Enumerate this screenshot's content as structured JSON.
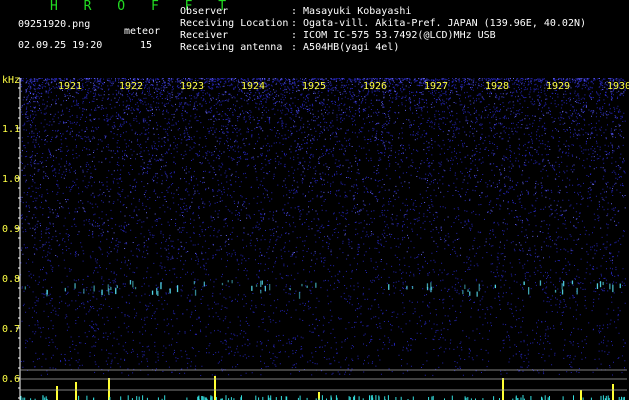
{
  "header": {
    "title": "H R O F F T",
    "filename": "09251920.png",
    "datetime": "02.09.25 19:20",
    "meteor_label": "meteor",
    "meteor_count": "15",
    "info": [
      {
        "label": "Observer",
        "value": ": Masayuki Kobayashi"
      },
      {
        "label": "Receiving Location",
        "value": ": Ogata-vill. Akita-Pref. JAPAN (139.96E, 40.02N)"
      },
      {
        "label": "Receiver",
        "value": ": ICOM IC-575 53.7492(@LCD)MHz USB"
      },
      {
        "label": "Receiving antenna",
        "value": ": A504HB(yagi 4el)"
      }
    ]
  },
  "axis": {
    "unit": "kHz",
    "y_labels": [
      "1.1",
      "1.0",
      "0.9",
      "0.8",
      "0.7",
      "0.6"
    ],
    "x_labels": [
      "1921",
      "1922",
      "1923",
      "1924",
      "1925",
      "1926",
      "1927",
      "1928",
      "1929",
      "1930"
    ]
  },
  "colors": {
    "title": "#22dd22",
    "text": "#ffffff",
    "tick_labels": "#ffff44",
    "axis": "#ffffff",
    "noise": "#2828c8",
    "echo": "#55ddee",
    "spike": "#ffff33"
  }
}
